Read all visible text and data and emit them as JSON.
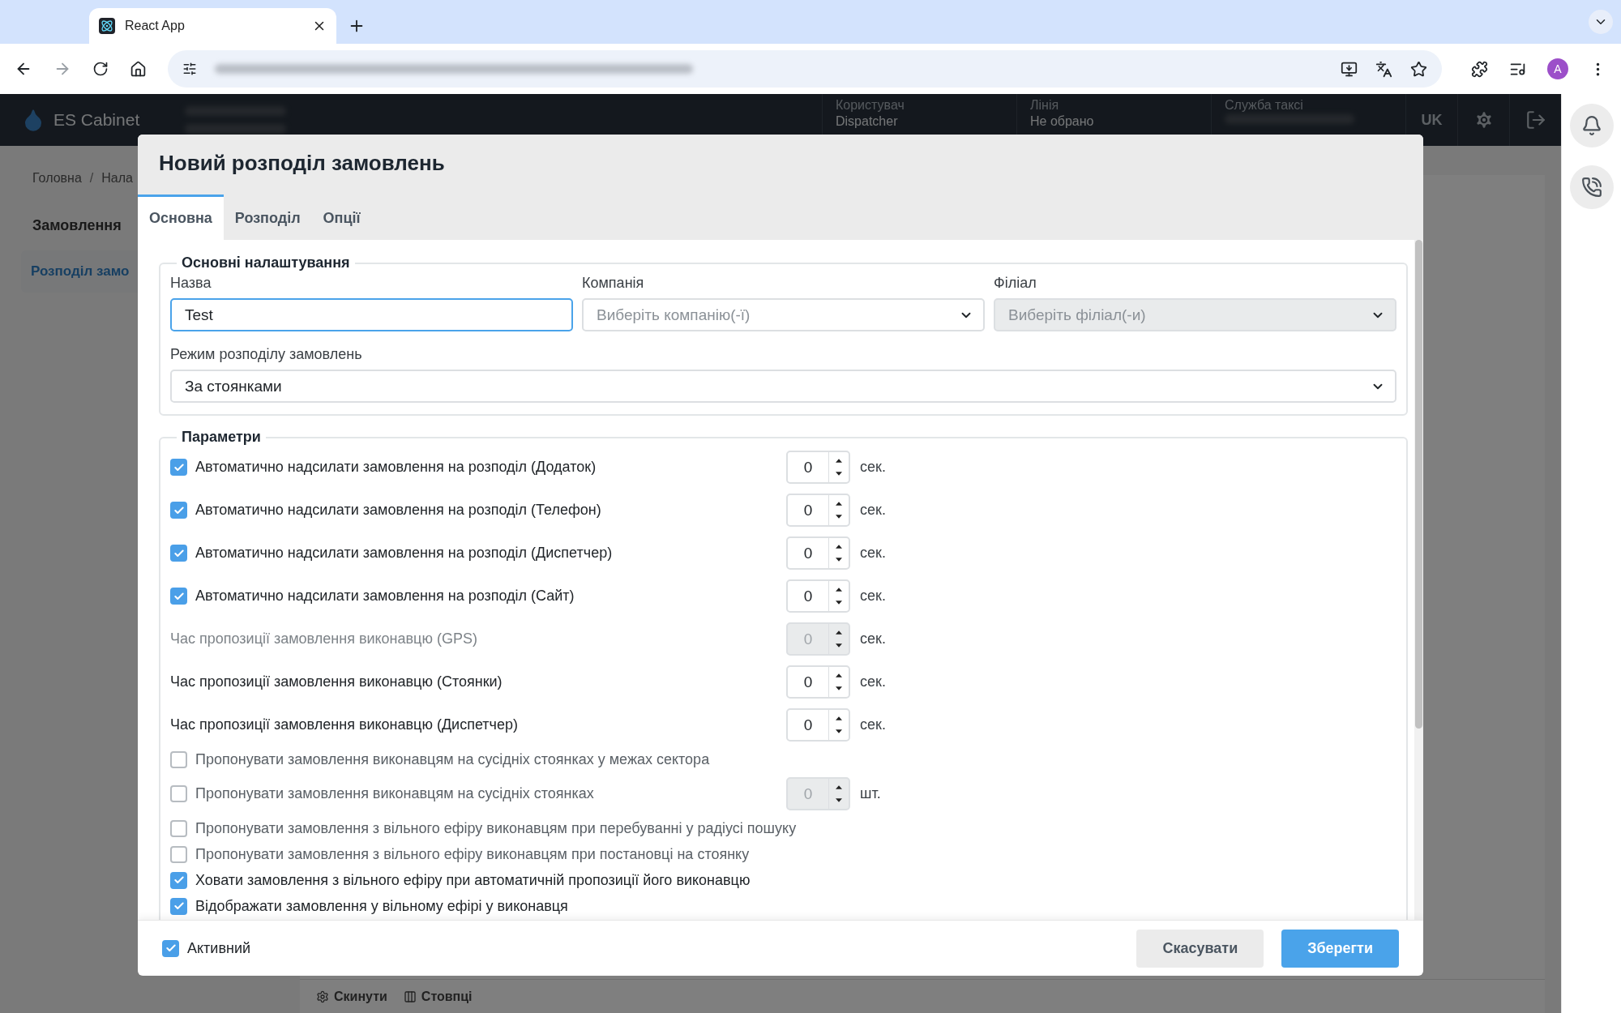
{
  "browser": {
    "tab_title": "React App",
    "avatar_letter": "A"
  },
  "header": {
    "brand": "ES Cabinet",
    "info": [
      {
        "label": "Користувач",
        "value": "Dispatcher"
      },
      {
        "label": "Лінія",
        "value": "Не обрано"
      },
      {
        "label": "Служба таксі"
      }
    ],
    "language": "UK"
  },
  "page": {
    "breadcrumb": [
      "Головна",
      "Нала"
    ],
    "breadcrumb_separator": "/",
    "sidebar_title": "Замовлення",
    "sidebar_items": [
      {
        "label": "Розподіл замо",
        "selected": true
      }
    ],
    "toolbar": [
      "Скинути",
      "Стовпці"
    ]
  },
  "modal": {
    "title": "Новий розподіл замовлень",
    "tabs": [
      {
        "label": "Основна",
        "selected": true
      },
      {
        "label": "Розподіл",
        "selected": false
      },
      {
        "label": "Опції",
        "selected": false
      }
    ],
    "basic": {
      "legend": "Основні налаштування",
      "name": {
        "label": "Назва",
        "value": "Test",
        "focused": true
      },
      "company": {
        "label": "Компанія",
        "placeholder": "Виберіть компанію(-ї)",
        "disabled": false
      },
      "branch": {
        "label": "Філіал",
        "placeholder": "Виберіть філіал(-и)",
        "disabled": true
      },
      "mode": {
        "label": "Режим розподілу замовлень",
        "value": "За стоянками"
      }
    },
    "params": {
      "legend": "Параметри",
      "rows": [
        {
          "kind": "checkbox_number",
          "label": "Автоматично надсилати замовлення на розподіл (Додаток)",
          "checked": true,
          "value": "0",
          "unit": "сек.",
          "disabled": false
        },
        {
          "kind": "checkbox_number",
          "label": "Автоматично надсилати замовлення на розподіл (Телефон)",
          "checked": true,
          "value": "0",
          "unit": "сек.",
          "disabled": false
        },
        {
          "kind": "checkbox_number",
          "label": "Автоматично надсилати замовлення на розподіл (Диспетчер)",
          "checked": true,
          "value": "0",
          "unit": "сек.",
          "disabled": false
        },
        {
          "kind": "checkbox_number",
          "label": "Автоматично надсилати замовлення на розподіл (Сайт)",
          "checked": true,
          "value": "0",
          "unit": "сек.",
          "disabled": false
        },
        {
          "kind": "number",
          "label": "Час пропозиції замовлення виконавцю (GPS)",
          "value": "0",
          "unit": "сек.",
          "disabled": true
        },
        {
          "kind": "number",
          "label": "Час пропозиції замовлення виконавцю (Стоянки)",
          "value": "0",
          "unit": "сек.",
          "disabled": false
        },
        {
          "kind": "number",
          "label": "Час пропозиції замовлення виконавцю (Диспетчер)",
          "value": "0",
          "unit": "сек.",
          "disabled": false
        },
        {
          "kind": "checkbox",
          "label": "Пропонувати замовлення виконавцям на сусідніх стоянках у межах сектора",
          "checked": false
        },
        {
          "kind": "checkbox_number",
          "label": "Пропонувати замовлення виконавцям на сусідніх стоянках",
          "checked": false,
          "value": "0",
          "unit": "шт.",
          "disabled": true
        },
        {
          "kind": "checkbox",
          "label": "Пропонувати замовлення з вільного ефіру виконавцям при перебуванні у радіусі пошуку",
          "checked": false
        },
        {
          "kind": "checkbox",
          "label": "Пропонувати замовлення з вільного ефіру виконавцям при постановці на стоянку",
          "checked": false
        },
        {
          "kind": "checkbox",
          "label": "Ховати замовлення з вільного ефіру при автоматичній пропозиції його виконавцю",
          "checked": true
        },
        {
          "kind": "checkbox",
          "label": "Відображати замовлення у вільному ефірі у виконавця",
          "checked": true
        }
      ]
    },
    "footer": {
      "active": {
        "label": "Активний",
        "checked": true
      },
      "buttons": [
        {
          "label": "Скасувати",
          "kind": "secondary"
        },
        {
          "label": "Зберегти",
          "kind": "primary"
        }
      ]
    }
  }
}
